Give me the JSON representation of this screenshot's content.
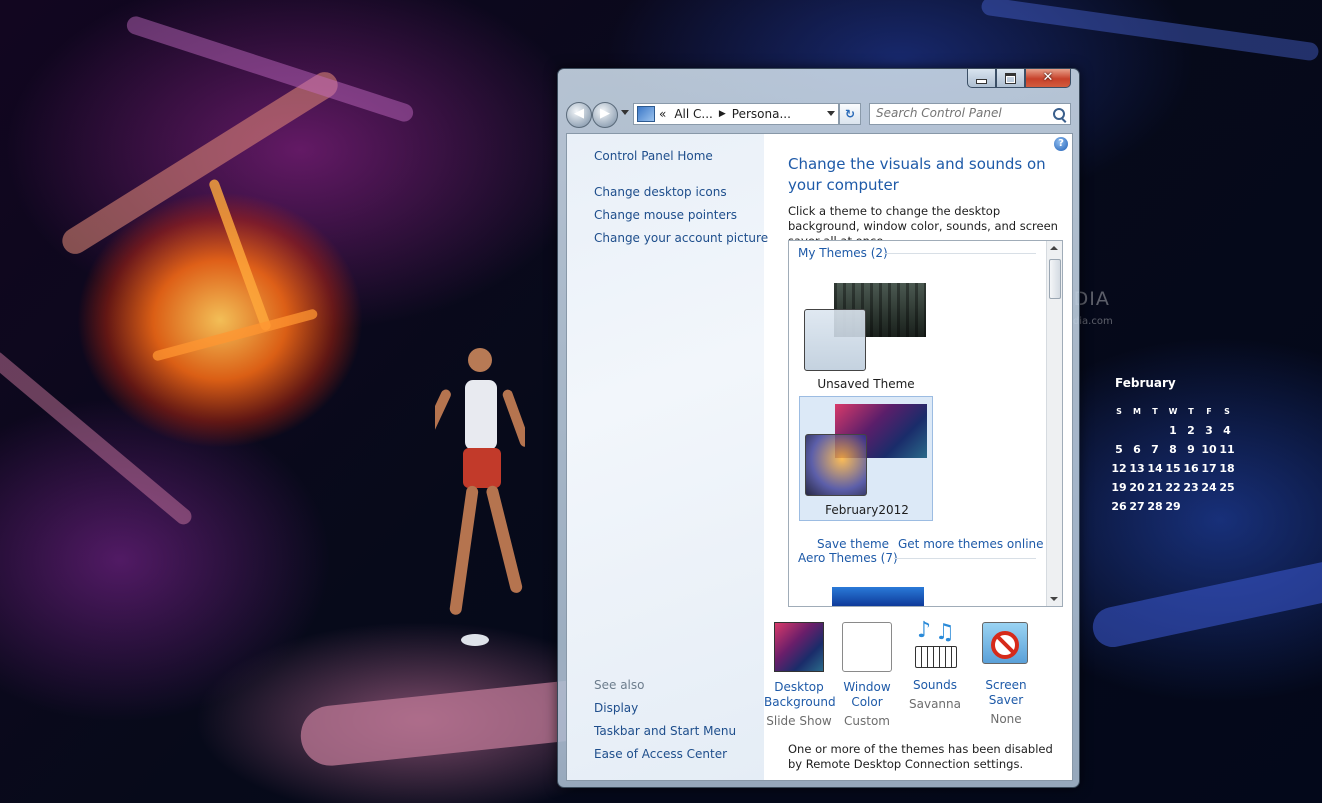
{
  "desktop": {
    "watermark": "SOFTPEDIA",
    "watermark_sub": "www.softpedia.com",
    "calendar": {
      "month": "February",
      "days_of_week": [
        "S",
        "M",
        "T",
        "W",
        "T",
        "F",
        "S"
      ],
      "weeks": [
        [
          "",
          "",
          "",
          "1",
          "2",
          "3",
          "4"
        ],
        [
          "5",
          "6",
          "7",
          "8",
          "9",
          "10",
          "11"
        ],
        [
          "12",
          "13",
          "14",
          "15",
          "16",
          "17",
          "18"
        ],
        [
          "19",
          "20",
          "21",
          "22",
          "23",
          "24",
          "25"
        ],
        [
          "26",
          "27",
          "28",
          "29",
          "",
          "",
          ""
        ]
      ]
    }
  },
  "window": {
    "controls": {
      "minimize": "minimize",
      "maximize": "maximize",
      "close": "✕"
    },
    "address": {
      "overflow": "«",
      "segments": [
        "All C...",
        "Persona..."
      ],
      "separator": "▶"
    },
    "search": {
      "placeholder": "Search Control Panel"
    },
    "nav": {
      "back": "◀",
      "forward": "▶",
      "refresh": "↻"
    }
  },
  "sidebar": {
    "home": "Control Panel Home",
    "tasks": [
      "Change desktop icons",
      "Change mouse pointers",
      "Change your account picture"
    ],
    "see_also_label": "See also",
    "see_also": [
      "Display",
      "Taskbar and Start Menu",
      "Ease of Access Center"
    ]
  },
  "main": {
    "help": "?",
    "title": "Change the visuals and sounds on your computer",
    "description": "Click a theme to change the desktop background, window color, sounds, and screen saver all at once.",
    "groups": {
      "my_themes": "My Themes (2)",
      "aero_themes": "Aero Themes (7)"
    },
    "themes": [
      {
        "name": "Unsaved Theme",
        "selected": false
      },
      {
        "name": "February2012",
        "selected": true
      }
    ],
    "save_theme": "Save theme",
    "get_more": "Get more themes online",
    "options": [
      {
        "title_line1": "Desktop",
        "title_line2": "Background",
        "value": "Slide Show",
        "icon": "desktop-background-icon"
      },
      {
        "title_line1": "Window",
        "title_line2": "Color",
        "value": "Custom",
        "icon": "window-color-icon"
      },
      {
        "title_line1": "Sounds",
        "title_line2": "",
        "value": "Savanna",
        "icon": "sounds-icon"
      },
      {
        "title_line1": "Screen Saver",
        "title_line2": "",
        "value": "None",
        "icon": "screen-saver-icon"
      }
    ],
    "footer_note": "One or more of the themes has been disabled by Remote Desktop Connection settings."
  }
}
